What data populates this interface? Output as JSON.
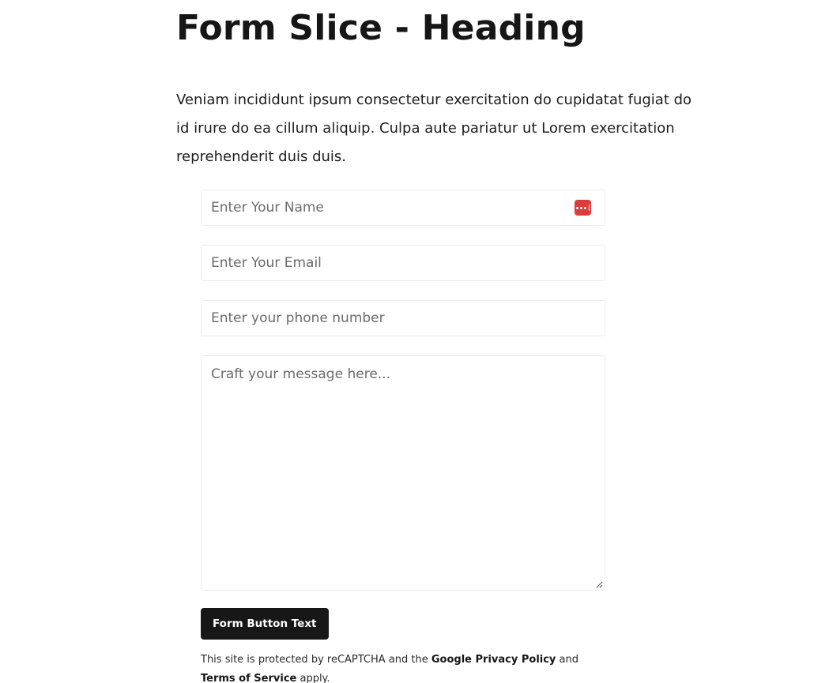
{
  "heading": "Form Slice - Heading",
  "intro": "Veniam incididunt ipsum consectetur exercitation do cupidatat fugiat do id irure do ea cillum aliquip. Culpa aute pariatur ut Lorem exercitation reprehenderit duis duis.",
  "form": {
    "name_placeholder": "Enter Your Name",
    "email_placeholder": "Enter Your Email",
    "phone_placeholder": "Enter your phone number",
    "message_placeholder": "Craft your message here...",
    "submit_label": "Form Button Text",
    "password_manager_icon": "password-manager-icon",
    "password_manager_color": "#dd3c3c"
  },
  "recaptcha": {
    "prefix": "This site is protected by reCAPTCHA and the ",
    "privacy_link": "Google Privacy Policy",
    "middle": " and ",
    "terms_link": "Terms of Service",
    "suffix": " apply."
  }
}
